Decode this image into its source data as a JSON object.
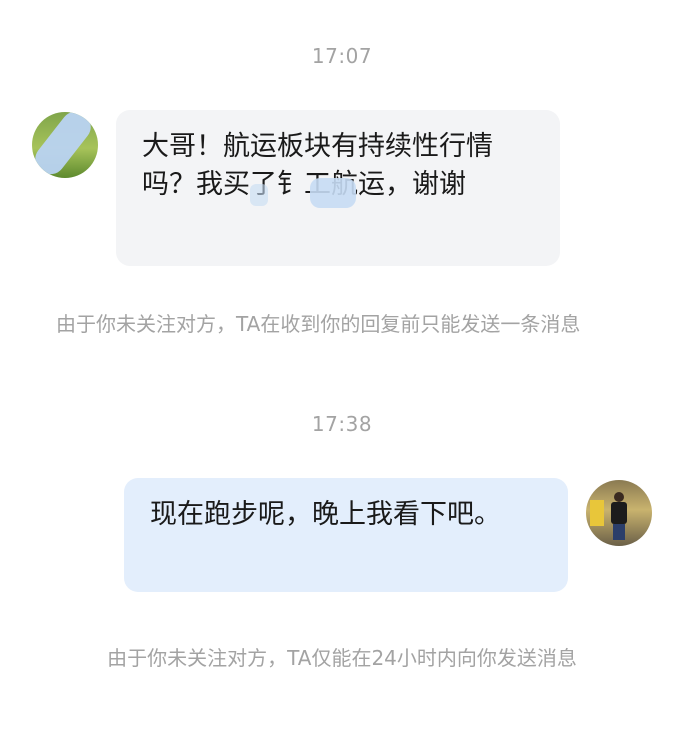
{
  "messages": [
    {
      "timestamp": "17:07",
      "sender": "other",
      "text": "大哥！航运板块有持续性行情吗？我买了钅工航运，谢谢",
      "notice": "由于你未关注对方，TA在收到你的回复前只能发送一条消息"
    },
    {
      "timestamp": "17:38",
      "sender": "self",
      "text": "现在跑步呢，晚上我看下吧。",
      "notice": "由于你未关注对方，TA仅能在24小时内向你发送消息"
    }
  ],
  "colors": {
    "incoming_bubble": "#f3f4f6",
    "outgoing_bubble": "#e3eefc",
    "meta_text": "#a3a3a3",
    "message_text": "#1a1a1a"
  },
  "icons": {
    "left_avatar": "avatar-photo",
    "right_avatar": "avatar-photo"
  }
}
